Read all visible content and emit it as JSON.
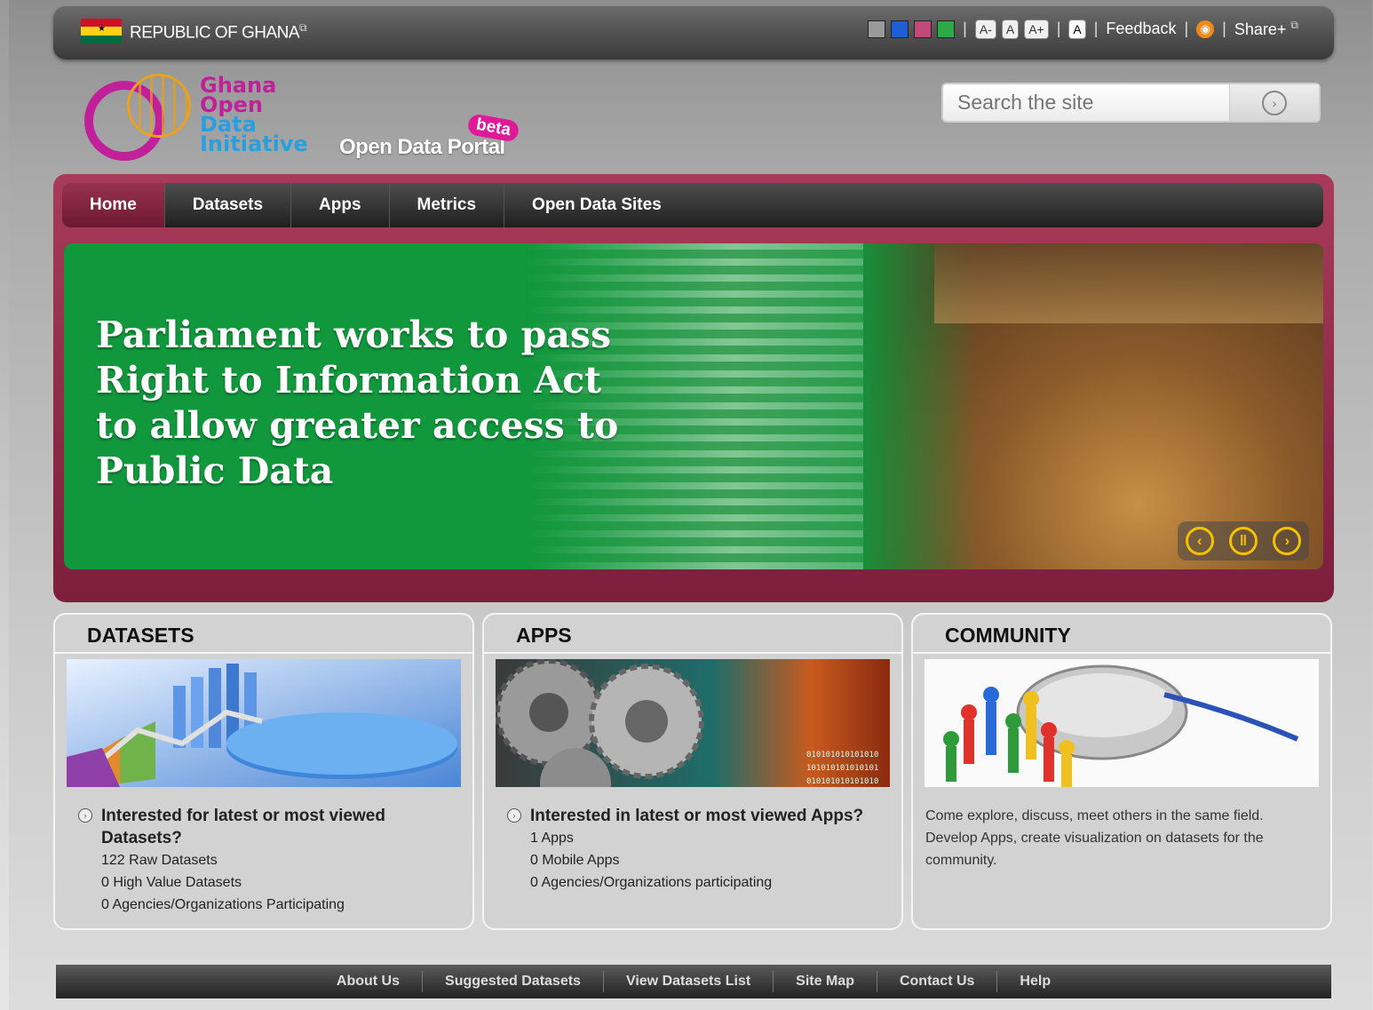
{
  "topbar": {
    "gov_label": "REPUBLIC OF GHANA",
    "font_buttons": [
      "A-",
      "A",
      "A+",
      "A"
    ],
    "feedback": "Feedback",
    "share": "Share+",
    "swatches": [
      "#9a9a9a",
      "#1f5fd6",
      "#c04a7a",
      "#2fa84a"
    ],
    "flag_colors": [
      "#ce1126",
      "#fcd116",
      "#006b3f"
    ]
  },
  "header": {
    "logo_lines": [
      "Ghana",
      "Open",
      "Data",
      "Initiative"
    ],
    "portal_title": "Open Data Portal",
    "beta": "beta",
    "search_placeholder": "Search the site"
  },
  "nav": {
    "items": [
      "Home",
      "Datasets",
      "Apps",
      "Metrics",
      "Open Data Sites"
    ],
    "active": "Home"
  },
  "slide": {
    "headline": [
      "Parliament  works to pass",
      "Right to Information Act",
      "to allow greater access to",
      "Public Data"
    ]
  },
  "panels": {
    "datasets": {
      "title": "DATASETS",
      "question": "Interested for latest or most viewed Datasets?",
      "stats": [
        "122 Raw Datasets",
        "0 High Value Datasets",
        "0 Agencies/Organizations Participating"
      ]
    },
    "apps": {
      "title": "APPS",
      "question": "Interested in latest or most viewed Apps?",
      "stats": [
        "1 Apps",
        "0 Mobile Apps",
        "0 Agencies/Organizations participating"
      ]
    },
    "community": {
      "title": "COMMUNITY",
      "text": "Come explore, discuss, meet others in the same field. Develop Apps, create visualization on datasets for the community."
    }
  },
  "footer": {
    "links": [
      "About Us",
      "Suggested Datasets",
      "View Datasets List",
      "Site Map",
      "Contact Us",
      "Help"
    ]
  },
  "colors": {
    "accent_maroon": "#8b2946",
    "slide_green": "#11973c",
    "beta_pink": "#e0189a"
  }
}
